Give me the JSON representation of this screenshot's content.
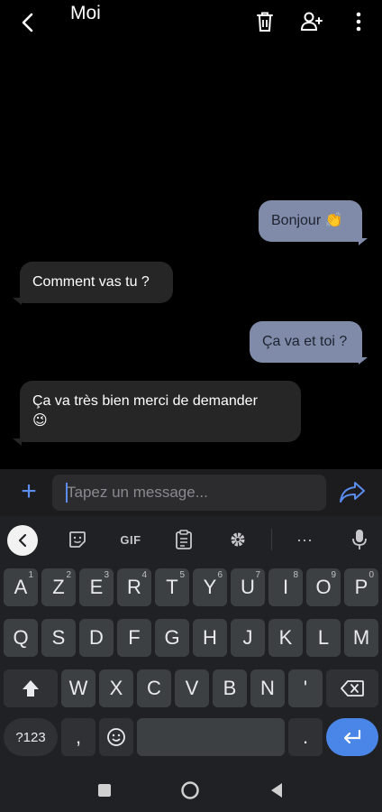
{
  "header": {
    "title": "Moi",
    "icons": [
      "back-arrow-icon",
      "trash-icon",
      "add-person-icon",
      "more-vertical-icon"
    ]
  },
  "messages": [
    {
      "direction": "out",
      "text": "Bonjour",
      "emoji": "👏"
    },
    {
      "direction": "in",
      "text": "Comment vas tu ?",
      "emoji": ""
    },
    {
      "direction": "out",
      "text": "Ça va et toi ?",
      "emoji": ""
    },
    {
      "direction": "in",
      "text": "Ça va très bien merci de demander",
      "emoji": "😉"
    }
  ],
  "composer": {
    "placeholder": "Tapez un message...",
    "value": ""
  },
  "keyboard": {
    "toolbar": {
      "gif_label": "GIF",
      "more_label": "···"
    },
    "row1": [
      {
        "label": "A",
        "hint": "1"
      },
      {
        "label": "Z",
        "hint": "2"
      },
      {
        "label": "E",
        "hint": "3"
      },
      {
        "label": "R",
        "hint": "4"
      },
      {
        "label": "T",
        "hint": "5"
      },
      {
        "label": "Y",
        "hint": "6"
      },
      {
        "label": "U",
        "hint": "7"
      },
      {
        "label": "I",
        "hint": "8"
      },
      {
        "label": "O",
        "hint": "9"
      },
      {
        "label": "P",
        "hint": "0"
      }
    ],
    "row2": [
      "Q",
      "S",
      "D",
      "F",
      "G",
      "H",
      "J",
      "K",
      "L",
      "M"
    ],
    "row3": [
      "W",
      "X",
      "C",
      "V",
      "B",
      "N",
      "'"
    ],
    "row4": {
      "symbols": "?123",
      "comma": ",",
      "period": "."
    }
  },
  "colors": {
    "accent": "#5b8def",
    "outgoing_bubble": "#7f8ba8",
    "incoming_bubble": "#262626",
    "enter_key": "#4a86e8"
  }
}
